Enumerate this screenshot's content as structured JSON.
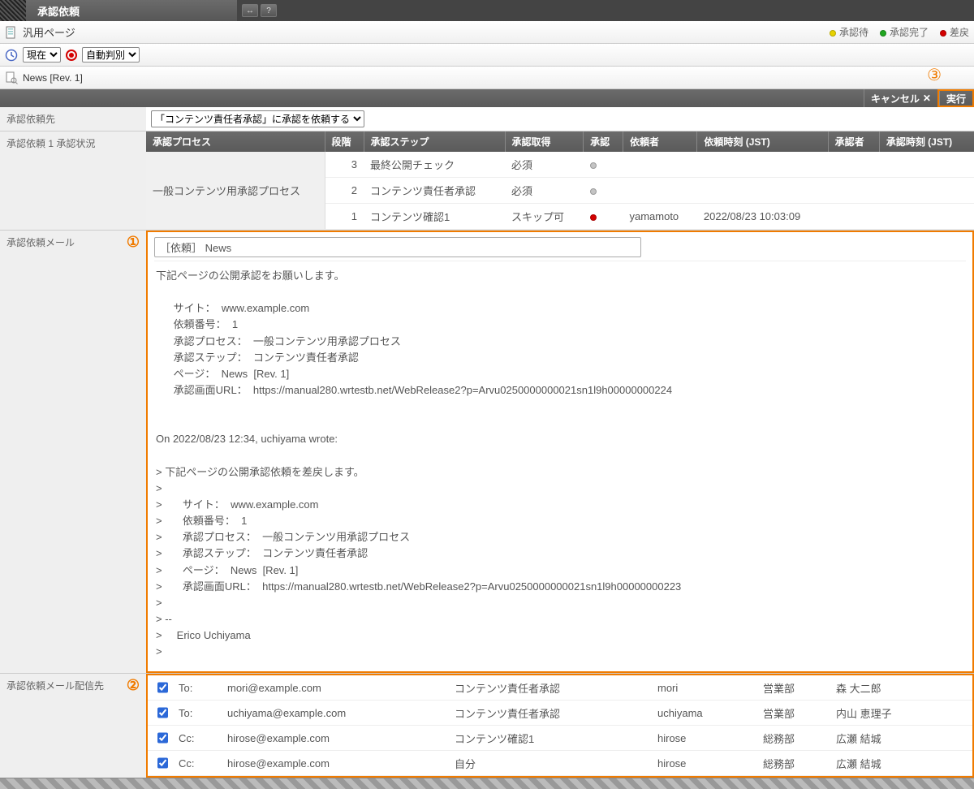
{
  "window_title": "承認依頼",
  "toolbar_buttons": {
    "toggle": "↔",
    "help": "?"
  },
  "page_kind_label": "汎用ページ",
  "status_legend": {
    "pending": "承認待",
    "done": "承認完了",
    "rejected": "差戻"
  },
  "time_select_options": [
    "現在"
  ],
  "detect_select_options": [
    "自動判別"
  ],
  "breadcrumb": "News [Rev. 1]",
  "circ3": "③",
  "action_cancel": "キャンセル",
  "action_exec": "実行",
  "form": {
    "dest_label": "承認依頼先",
    "dest_options": [
      "「コンテンツ責任者承認」に承認を依頼する"
    ],
    "status_label": "承認依頼 1 承認状況",
    "table_headers": {
      "process": "承認プロセス",
      "stage": "段階",
      "step": "承認ステップ",
      "required": "承認取得",
      "approval": "承認",
      "requester": "依頼者",
      "requested_at": "依頼時刻 (JST)",
      "approver": "承認者",
      "approved_at": "承認時刻 (JST)"
    },
    "process_name": "一般コンテンツ用承認プロセス",
    "rows": [
      {
        "stage": "3",
        "step": "最終公開チェック",
        "required": "必須",
        "approval_dot": "gray",
        "requester": "",
        "requested_at": "",
        "approver": "",
        "approved_at": ""
      },
      {
        "stage": "2",
        "step": "コンテンツ責任者承認",
        "required": "必須",
        "approval_dot": "gray",
        "requester": "",
        "requested_at": "",
        "approver": "",
        "approved_at": ""
      },
      {
        "stage": "1",
        "step": "コンテンツ確認1",
        "required": "スキップ可",
        "approval_dot": "red",
        "requester": "yamamoto",
        "requested_at": "2022/08/23 10:03:09",
        "approver": "",
        "approved_at": ""
      }
    ],
    "mail_label": "承認依頼メール",
    "mail_circ": "①",
    "mail_subject": "［依頼］ News",
    "mail_body": "下記ページの公開承認をお願いします。\n\n      サイト：  www.example.com\n      依頼番号：  1\n      承認プロセス：  一般コンテンツ用承認プロセス\n      承認ステップ：  コンテンツ責任者承認\n      ページ：  News  [Rev. 1]\n      承認画面URL：  https://manual280.wrtestb.net/WebRelease2?p=Arvu0250000000021sn1l9h00000000224\n\n\nOn 2022/08/23 12:34, uchiyama wrote:\n\n> 下記ページの公開承認依頼を差戻します。\n>\n>       サイト：  www.example.com\n>       依頼番号：  1\n>       承認プロセス：  一般コンテンツ用承認プロセス\n>       承認ステップ：  コンテンツ責任者承認\n>       ページ：  News  [Rev. 1]\n>       承認画面URL：  https://manual280.wrtestb.net/WebRelease2?p=Arvu0250000000021sn1l9h00000000223\n>\n> --\n>     Erico Uchiyama\n>",
    "recip_label": "承認依頼メール配信先",
    "recip_circ": "②",
    "recipients": [
      {
        "checked": true,
        "kind": "To:",
        "email": "mori@example.com",
        "step": "コンテンツ責任者承認",
        "user": "mori",
        "dept": "営業部",
        "name": "森 大二郎"
      },
      {
        "checked": true,
        "kind": "To:",
        "email": "uchiyama@example.com",
        "step": "コンテンツ責任者承認",
        "user": "uchiyama",
        "dept": "営業部",
        "name": "内山 恵理子"
      },
      {
        "checked": true,
        "kind": "Cc:",
        "email": "hirose@example.com",
        "step": "コンテンツ確認1",
        "user": "hirose",
        "dept": "総務部",
        "name": "広瀬 結城"
      },
      {
        "checked": true,
        "kind": "Cc:",
        "email": "hirose@example.com",
        "step": "自分",
        "user": "hirose",
        "dept": "総務部",
        "name": "広瀬 結城"
      }
    ]
  }
}
